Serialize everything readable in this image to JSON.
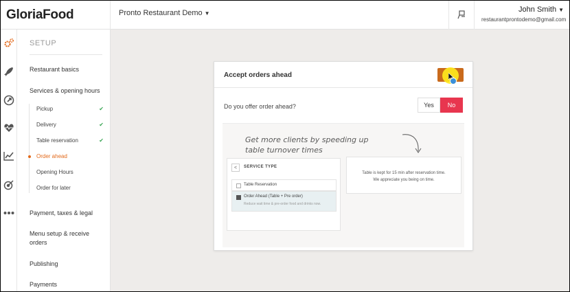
{
  "brand": {
    "logo_text": "GloriaFood",
    "accent": "#e36a1b"
  },
  "header": {
    "restaurant": "Pronto Restaurant Demo",
    "user_name": "John Smith",
    "user_email": "restaurantprontodemo@gmail.com"
  },
  "rail": {
    "icons": [
      "gears-icon",
      "rocket-icon",
      "compass-icon",
      "heart-pulse-icon",
      "line-chart-icon",
      "target-icon",
      "more-dots-icon"
    ]
  },
  "sidebar": {
    "section_label": "SETUP",
    "items": [
      {
        "label": "Restaurant basics"
      },
      {
        "label": "Services & opening hours"
      },
      {
        "label": "Payment, taxes & legal"
      },
      {
        "label": "Menu setup & receive orders"
      },
      {
        "label": "Publishing"
      },
      {
        "label": "Payments"
      }
    ],
    "sub_items": [
      {
        "label": "Pickup",
        "done": true
      },
      {
        "label": "Delivery",
        "done": true
      },
      {
        "label": "Table reservation",
        "done": true
      },
      {
        "label": "Order ahead",
        "active": true
      },
      {
        "label": "Opening Hours"
      },
      {
        "label": "Order for later"
      }
    ]
  },
  "card": {
    "title": "Accept orders ahead",
    "question": "Do you offer order ahead?",
    "yes_label": "Yes",
    "no_label": "No",
    "selected": "No",
    "promo_line1": "Get more clients by speeding up",
    "promo_line2": "table turnover times",
    "mini": {
      "back": "<",
      "title": "SERVICE TYPE",
      "option1": "Table Reservation",
      "option2": "Order Ahead (Table + Pre order)",
      "option2_sub": "Reduce wait time & pre-order food and drinks now."
    },
    "info_line1": "Table is kept for 15 min after reservation time.",
    "info_line2": "We appreciate you being on time."
  },
  "colors": {
    "no_active": "#e8364f",
    "check": "#3aa655",
    "toggle": "#c96a1c"
  }
}
